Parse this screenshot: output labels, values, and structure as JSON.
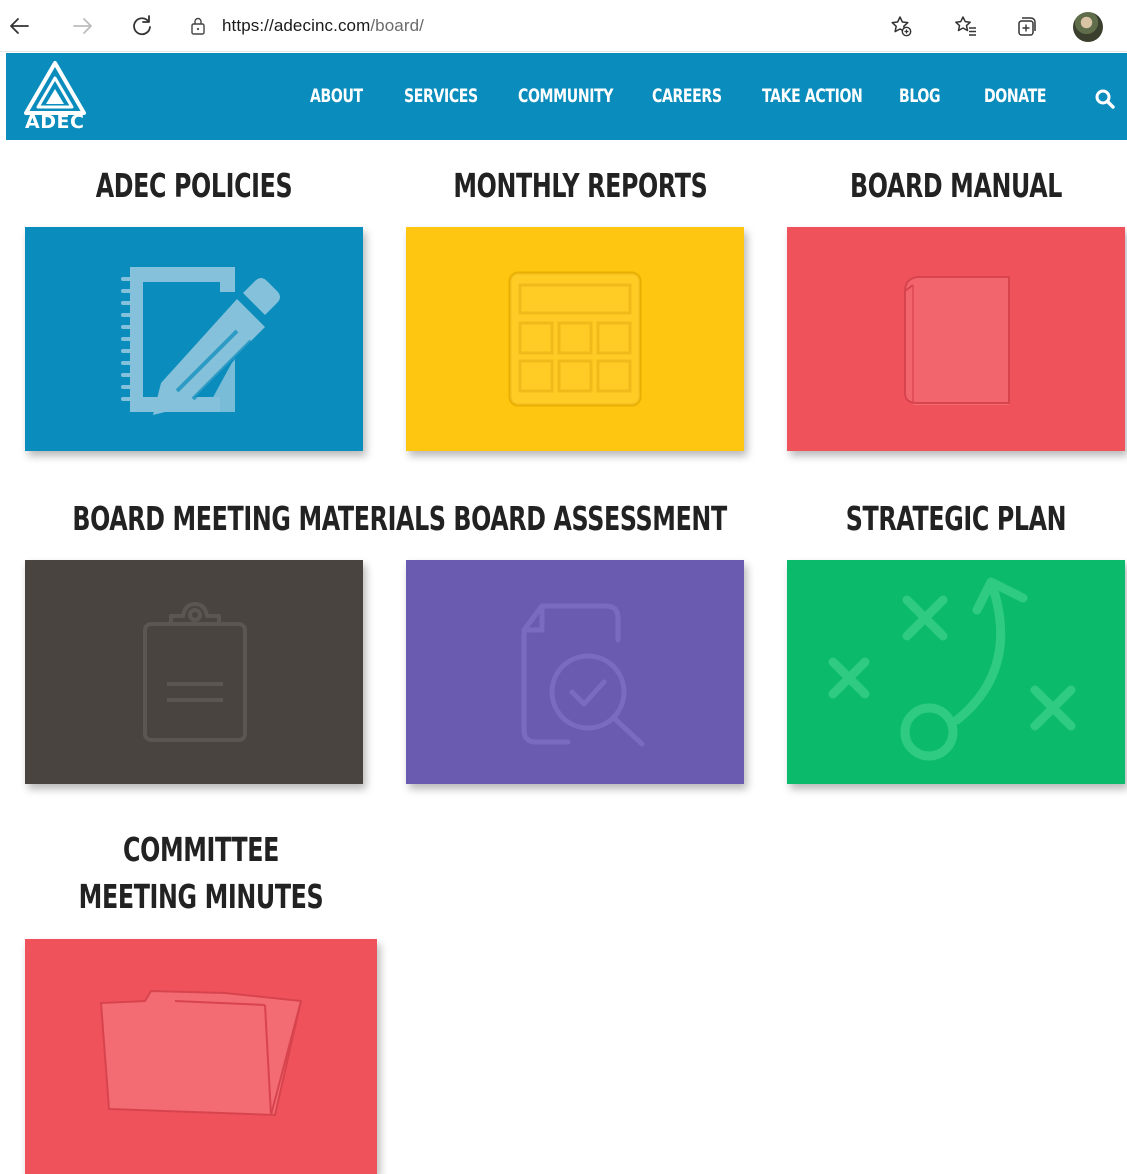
{
  "browser": {
    "url_base": "https://adecinc.com",
    "url_path": "/board/"
  },
  "site": {
    "logo_text": "ADEC",
    "nav": [
      "ABOUT",
      "SERVICES",
      "COMMUNITY",
      "CAREERS",
      "TAKE ACTION",
      "BLOG",
      "DONATE"
    ]
  },
  "tiles": [
    {
      "title": "ADEC POLICIES",
      "color": "#0a8cbc",
      "icon": "notebook-pencil-icon"
    },
    {
      "title": "MONTHLY REPORTS",
      "color": "#ffc611",
      "icon": "calendar-grid-icon"
    },
    {
      "title": "BOARD MANUAL",
      "color": "#f0525c",
      "icon": "book-icon"
    },
    {
      "title": "BOARD MEETING MATERIALS",
      "color": "#4a4440",
      "icon": "clipboard-icon"
    },
    {
      "title": "BOARD ASSESSMENT",
      "color": "#6a5ab0",
      "icon": "document-search-check-icon"
    },
    {
      "title": "STRATEGIC PLAN",
      "color": "#0cba6c",
      "icon": "strategy-play-icon"
    },
    {
      "title": "COMMITTEE MEETING MINUTES",
      "color": "#f0525c",
      "icon": "folder-icon"
    }
  ],
  "colors": {
    "header": "#0a8cbc",
    "heading_text": "#222222"
  }
}
